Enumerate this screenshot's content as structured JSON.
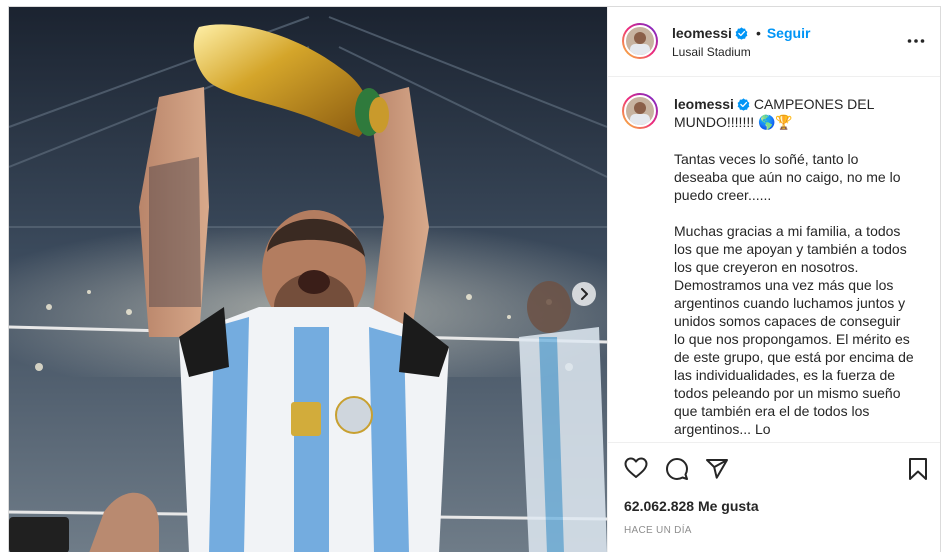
{
  "post": {
    "image_alt": "Jugador levantando la copa del mundo en el estadio",
    "username": "leomessi",
    "follow_label": "Seguir",
    "dot": "•",
    "location": "Lusail Stadium",
    "caption_title": "CAMPEONES DEL MUNDO!!!!!!! 🌎🏆",
    "caption_paragraphs": [
      "Tantas veces lo soñé, tanto lo deseaba que aún no caigo, no me lo puedo creer......",
      "Muchas gracias a mi familia, a todos los que me apoyan y también a todos los que creyeron en nosotros. Demostramos una vez más que los argentinos cuando luchamos juntos y unidos somos capaces de conseguir lo que nos propongamos. El mérito es de este grupo, que está por encima de las individualidades, es la fuerza de todos peleando por un mismo sueño que también era el de todos los argentinos... Lo"
    ],
    "likes": "62.062.828 Me gusta",
    "time_ago": "HACE UN DÍA"
  },
  "colors": {
    "accent": "#0095f6",
    "text": "#262626",
    "muted": "#8e8e8e",
    "border": "#dbdbdb"
  },
  "icons": {
    "verified": "verified-badge-icon",
    "more": "more-options-icon",
    "like": "heart-icon",
    "comment": "comment-icon",
    "share": "share-icon",
    "save": "bookmark-icon",
    "next": "chevron-right-icon"
  }
}
